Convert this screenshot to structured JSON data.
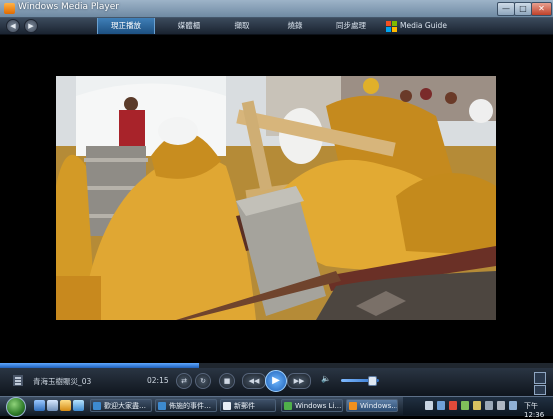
{
  "window": {
    "title": "Windows Media Player"
  },
  "nav": {
    "tabs": [
      {
        "label": "現正播放",
        "active": true
      },
      {
        "label": "媒體櫃",
        "active": false
      },
      {
        "label": "擷取",
        "active": false
      },
      {
        "label": "燒錄",
        "active": false
      },
      {
        "label": "同步處理",
        "active": false
      },
      {
        "label": "Media Guide",
        "active": false
      }
    ]
  },
  "video": {
    "description_icon": "video-frame"
  },
  "player": {
    "now_playing": "青海玉樹賑災_03",
    "elapsed": "02:15",
    "progress": 0.36,
    "volume": 0.8,
    "accent_color": "#2d6fc8"
  },
  "taskbar": {
    "tasks": [
      {
        "label": "歡迎大家盡…"
      },
      {
        "label": "佈施的事件…"
      },
      {
        "label": "新郵件"
      },
      {
        "label": "Windows Li…"
      },
      {
        "label": "Windows…",
        "active": true
      }
    ],
    "clock": "下午 12:36"
  }
}
